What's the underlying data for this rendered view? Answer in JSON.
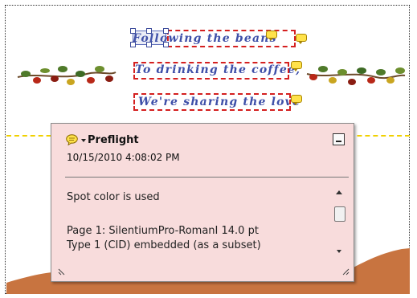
{
  "artwork": {
    "lines": [
      {
        "text": "Following the beans"
      },
      {
        "text": "To drinking the coffee,"
      },
      {
        "text": "We're sharing the love"
      }
    ]
  },
  "popup": {
    "title": "Preflight",
    "timestamp": "10/15/2010 4:08:02 PM",
    "body_lines": [
      "Spot color is used",
      "",
      "Page 1: SilentiumPro-RomanI 14.0 pt",
      "Type 1 (CID)  embedded (as a subset)"
    ]
  },
  "colors": {
    "popup_background": "#f8dcdc",
    "note_icon": "#ffe24a",
    "annotation_outline": "#d42020",
    "guide_line": "#f0d000",
    "text_blue": "#3e4fa8"
  },
  "icons": {
    "comment": "speech-bubble-icon",
    "minimize": "minimize-icon",
    "scroll_up": "arrow-up-icon",
    "scroll_down": "arrow-down-icon"
  }
}
